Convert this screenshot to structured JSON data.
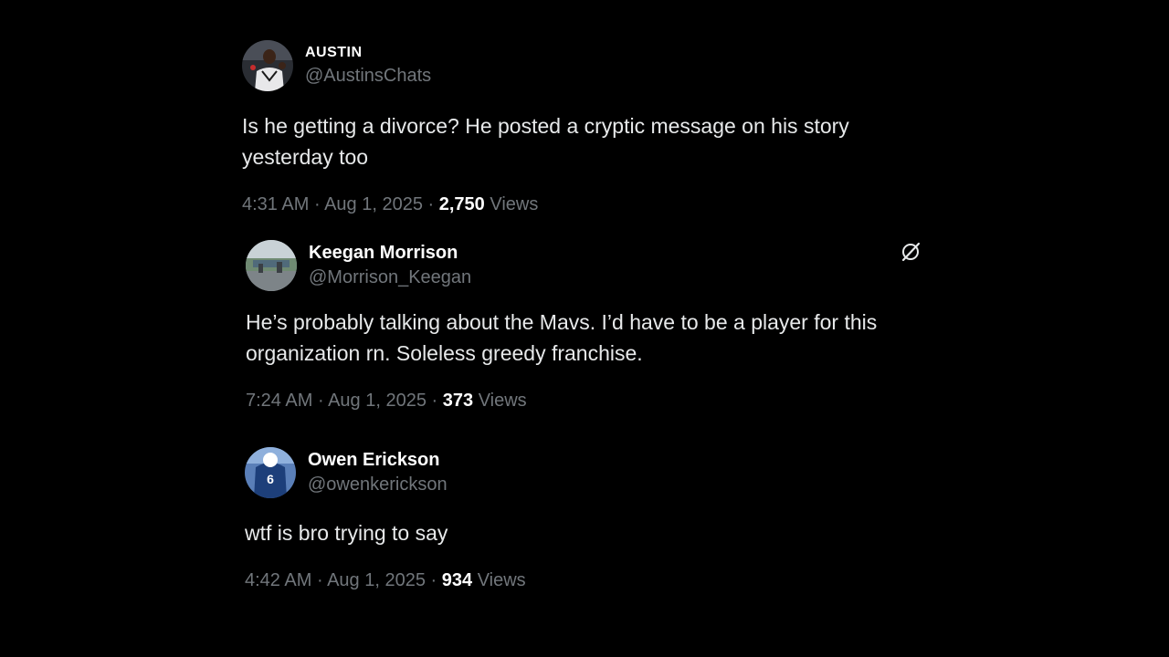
{
  "tweets": [
    {
      "display_name": "AUSTIN",
      "handle": "@AustinsChats",
      "text": "Is he getting a divorce? He posted a cryptic message on his story yesterday too",
      "time": "4:31 AM",
      "separator": "·",
      "date": "Aug 1, 2025",
      "views_count": "2,750",
      "views_label": "Views",
      "avatar_icon": "basketball-player-avatar"
    },
    {
      "display_name": "Keegan Morrison",
      "handle": "@Morrison_Keegan",
      "text": "He’s probably talking about the Mavs. I’d have to be a player for this organization rn. Soleless greedy franchise.",
      "time": "7:24 AM",
      "separator": "·",
      "date": "Aug 1, 2025",
      "views_count": "373",
      "views_label": "Views",
      "avatar_icon": "outdoor-scene-avatar",
      "action_icon": "grok-icon"
    },
    {
      "display_name": "Owen Erickson",
      "handle": "@owenkerickson",
      "text": "wtf is bro trying to say",
      "time": "4:42 AM",
      "separator": "·",
      "date": "Aug 1, 2025",
      "views_count": "934",
      "views_label": "Views",
      "avatar_icon": "jersey-number-6-avatar",
      "jersey_number": "6"
    }
  ],
  "colors": {
    "background": "#000000",
    "primary_text": "#e7e9ea",
    "secondary_text": "#71767b",
    "jersey_blue": "#1d3f7a"
  }
}
